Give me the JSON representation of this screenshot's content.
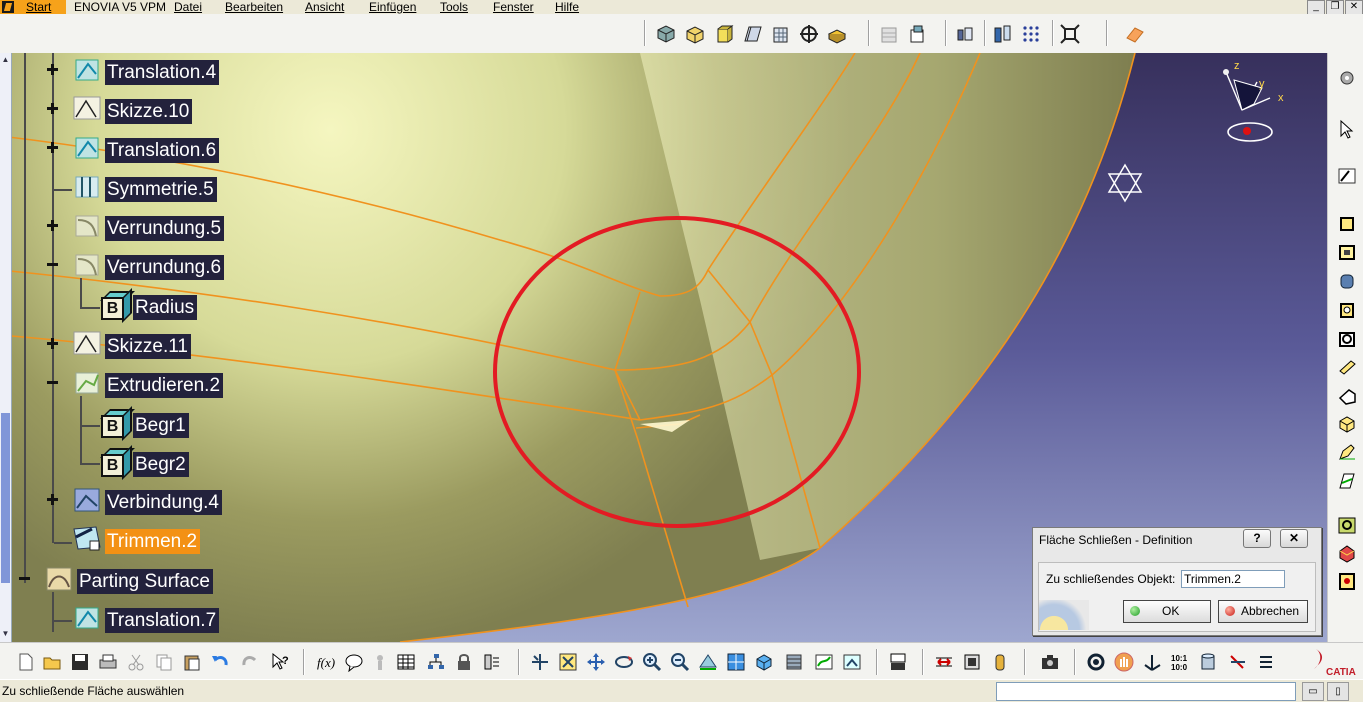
{
  "menubar": {
    "start_label": "Start",
    "items": [
      "ENOVIA V5 VPM",
      "Datei",
      "Bearbeiten",
      "Ansicht",
      "Einfügen",
      "Tools",
      "Fenster",
      "Hilfe"
    ],
    "window_buttons": [
      "_",
      "❐",
      "✕"
    ]
  },
  "tree": {
    "nodes": [
      {
        "label": "Translation.4",
        "expander": "plus"
      },
      {
        "label": "Skizze.10",
        "expander": "plus"
      },
      {
        "label": "Translation.6",
        "expander": "plus"
      },
      {
        "label": "Symmetrie.5",
        "expander": "none"
      },
      {
        "label": "Verrundung.5",
        "expander": "plus"
      },
      {
        "label": "Verrundung.6",
        "expander": "minus"
      },
      {
        "label": "Radius",
        "expander": "none"
      },
      {
        "label": "Skizze.11",
        "expander": "plus"
      },
      {
        "label": "Extrudieren.2",
        "expander": "minus"
      },
      {
        "label": "Begr1",
        "expander": "none"
      },
      {
        "label": "Begr2",
        "expander": "none"
      },
      {
        "label": "Verbindung.4",
        "expander": "plus"
      },
      {
        "label": "Trimmen.2",
        "expander": "none",
        "selected": true
      },
      {
        "label": "Parting Surface",
        "expander": "minus"
      },
      {
        "label": "Translation.7",
        "expander": "none"
      }
    ],
    "b_letter": "B"
  },
  "compass": {
    "x_label": "x",
    "y_label": "y",
    "z_label": "z"
  },
  "dialog": {
    "title": "Fläche Schließen - Definition",
    "help_button": "?",
    "close_button": "✕",
    "object_label": "Zu schließendes Objekt:",
    "object_value": "Trimmen.2",
    "ok_label": "OK",
    "cancel_label": "Abbrechen"
  },
  "status": {
    "message": "Zu schließende Fläche auswählen",
    "command_input": ""
  },
  "branding": {
    "catia_label": "CATIA"
  },
  "colors": {
    "viewport_background": "#5a5894",
    "surface": "#9a9c60",
    "surface_highlight": "#e8ecb0",
    "edge_orange": "#f0921e",
    "annotation_circle": "#e31b23",
    "tree_label_bg": "#23223c",
    "selected_label_bg": "#f39114"
  },
  "icons": {
    "top_toolbar": [
      "view-icon",
      "box-icon",
      "cube-icon",
      "parallelogram-icon",
      "grid-cube-icon",
      "target-icon",
      "shape-icon",
      "hidden-icon",
      "layer-icon",
      "3d-icon",
      "multi-view-icon",
      "dots-grid-icon",
      "fit-all-icon",
      "eraser-icon"
    ],
    "right_toolbar": [
      "settings-icon",
      "select-arrow-icon",
      "sketch-icon",
      "pad-icon",
      "pocket-icon",
      "shaft-icon",
      "hole-icon",
      "rib-icon",
      "slot-icon",
      "cube-small-icon",
      "edit-icon",
      "measure-icon",
      "curve-green-icon",
      "surface-red-icon",
      "shape-yellow-icon"
    ],
    "bottom_toolbar": [
      "new-icon",
      "open-icon",
      "save-icon",
      "print-icon",
      "cut-icon",
      "copy-icon",
      "paste-icon",
      "undo-icon",
      "redo-icon",
      "help-icon",
      "formula-icon",
      "chat-icon",
      "knowledge-icon",
      "table-icon",
      "tree-icon",
      "lock-icon",
      "constraints-icon",
      "move-icon",
      "zoom-fit-icon",
      "pan-icon",
      "rotate-icon",
      "zoom-in-icon",
      "zoom-out-icon",
      "normal-view-icon",
      "views-icon",
      "render-icon",
      "hide-icon",
      "swap-icon",
      "multi-view2-icon",
      "compare-icon",
      "ruler-icon",
      "measure2-icon",
      "mass-icon",
      "capture-icon",
      "sync-icon",
      "hand-icon",
      "axis-icon",
      "scale-icon",
      "cylinder-icon",
      "cut-plane-icon",
      "menu-icon"
    ]
  }
}
